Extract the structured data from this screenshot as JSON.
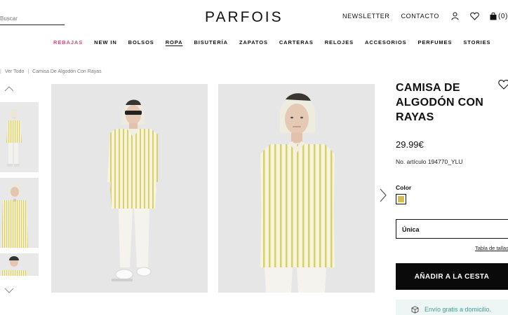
{
  "header": {
    "search_placeholder": "Buscar",
    "logo": "PARFOIS",
    "newsletter": "NEWSLETTER",
    "contact": "CONTACTO",
    "cart_count": "(0)"
  },
  "nav": {
    "items": [
      "REBAJAS",
      "NEW IN",
      "BOLSOS",
      "ROPA",
      "BISUTERÍA",
      "ZAPATOS",
      "CARTERAS",
      "RELOJES",
      "ACCESORIOS",
      "PERFUMES",
      "STORIES"
    ],
    "active": "ROPA"
  },
  "breadcrumb": [
    "Ver Todo",
    "Camisa De Algodón Con Rayas"
  ],
  "product": {
    "title": "CAMISA DE ALGODÓN CON RAYAS",
    "price": "29.99€",
    "reference": "No. artículo 194770_YLU",
    "color_label": "Color",
    "color_hex": "#d6b95a",
    "size_value": "Única",
    "size_table_link": "Tabla de tallas",
    "add_to_cart": "AÑADIR A LA CESTA",
    "shipping": "Envío gratis a domicilio."
  },
  "colors": {
    "sale": "#c4587e",
    "stripe": "#d9d06a",
    "button": "#0a0a0a",
    "shipping_bg": "#eef5f5",
    "shipping_text": "#4a9a9a"
  },
  "icons": [
    "user-icon",
    "heart-icon",
    "bag-icon",
    "chevron-up-icon",
    "chevron-down-icon",
    "chevron-right-icon",
    "box-icon"
  ]
}
